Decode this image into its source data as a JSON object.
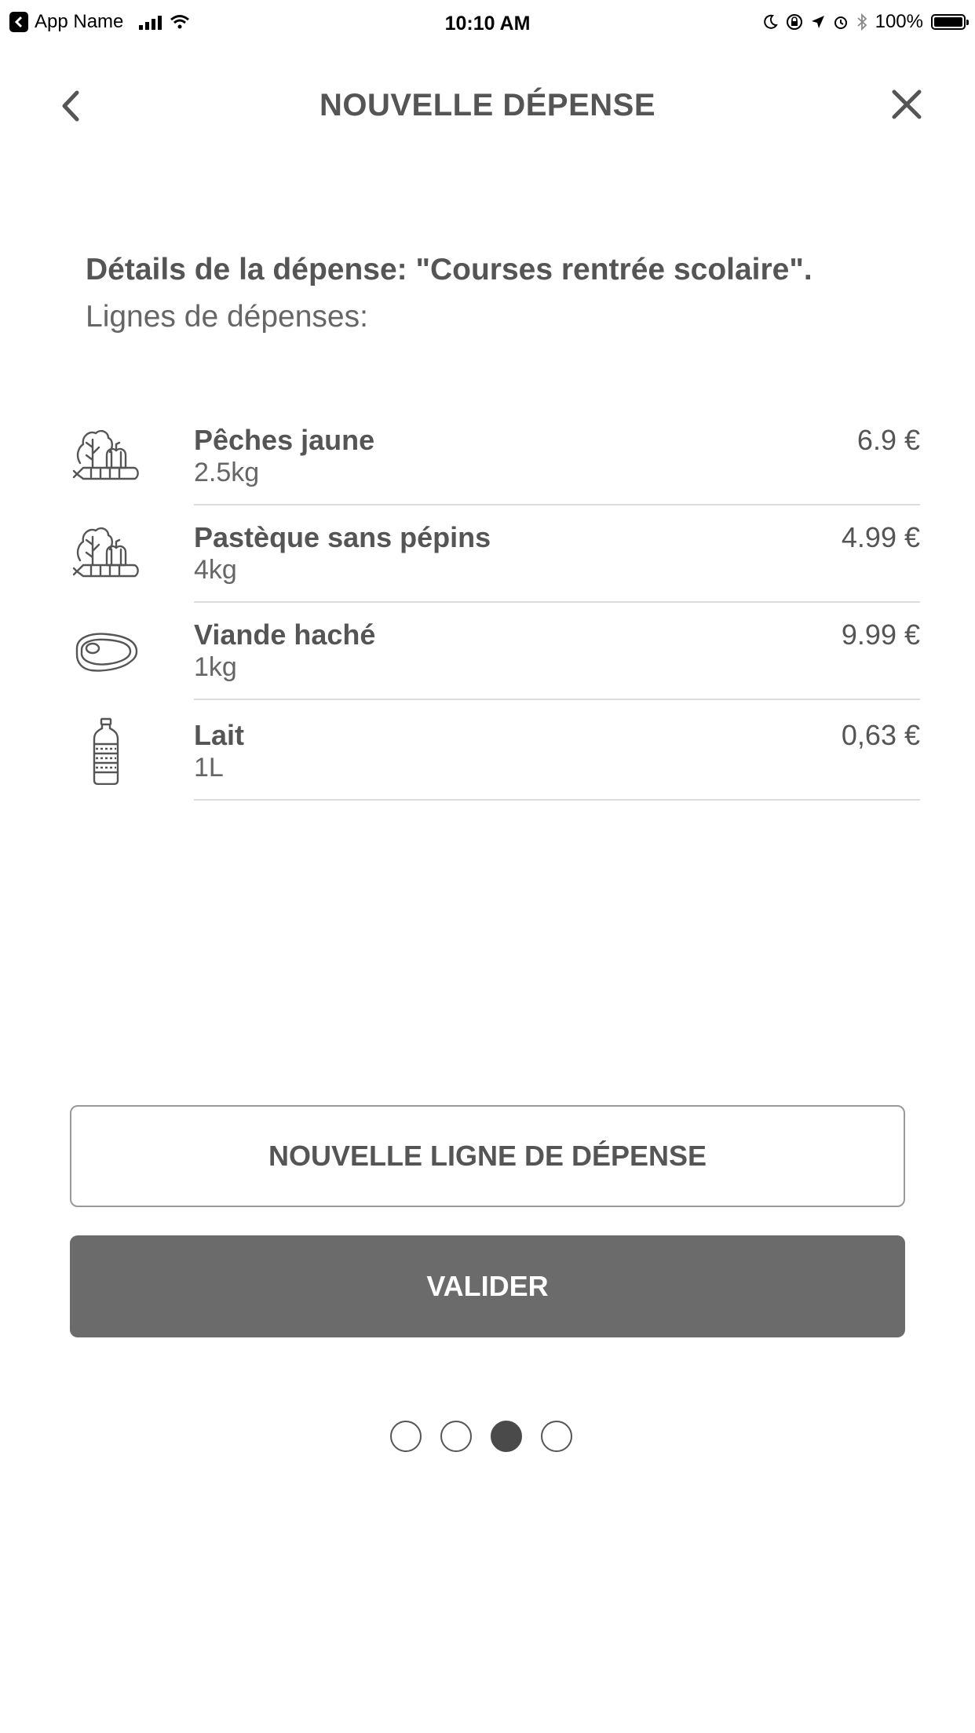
{
  "status_bar": {
    "app_name": "App Name",
    "time": "10:10 AM",
    "battery": "100%"
  },
  "header": {
    "title": "NOUVELLE DÉPENSE",
    "back_icon": "chevron-left-icon",
    "close_icon": "close-icon"
  },
  "intro": {
    "title": "Détails de la dépense: \"Courses rentrée scolaire\".",
    "subtitle": "Lignes de dépenses:"
  },
  "expenses": [
    {
      "icon": "vegetables-icon",
      "name": "Pêches jaune",
      "quantity": "2.5kg",
      "price": "6.9 €"
    },
    {
      "icon": "vegetables-icon",
      "name": "Pastèque sans pépins",
      "quantity": "4kg",
      "price": "4.99 €"
    },
    {
      "icon": "meat-icon",
      "name": "Viande haché",
      "quantity": "1kg",
      "price": "9.99 €"
    },
    {
      "icon": "bottle-icon",
      "name": "Lait",
      "quantity": "1L",
      "price": "0,63 €"
    }
  ],
  "buttons": {
    "new_line": "NOUVELLE LIGNE DE DÉPENSE",
    "validate": "VALIDER"
  },
  "pager": {
    "count": 4,
    "active_index": 2
  },
  "colors": {
    "text": "#555555",
    "primary_button": "#6b6b6b",
    "active_dot": "#4a4a4a"
  }
}
